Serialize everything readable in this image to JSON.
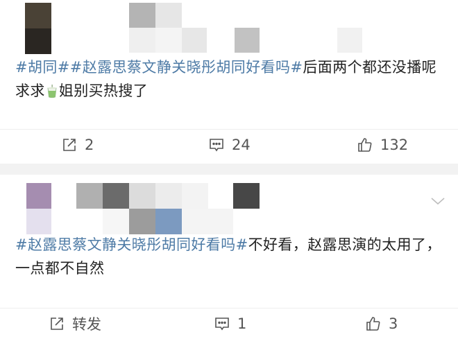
{
  "posts": [
    {
      "content": {
        "tag1": "#胡同#",
        "tag2": "#赵露思蔡文静关晓彤胡同好看吗#",
        "text1": "后面两个都还没播呢 求求",
        "emoji": "tea-cup-emoji",
        "text2": "姐别买热搜了"
      },
      "actions": {
        "repost": "2",
        "comment": "24",
        "like": "132"
      }
    },
    {
      "content": {
        "tag1": "#赵露思蔡文静关晓彤胡同好看吗#",
        "text1": "不好看，赵露思演的太用了，一点都不自然"
      },
      "actions": {
        "repost": "转发",
        "comment": "1",
        "like": "3"
      }
    }
  ],
  "colors": {
    "tag": "#4e7ba6",
    "separator": "#f2f2f2",
    "action_text": "#555555"
  }
}
